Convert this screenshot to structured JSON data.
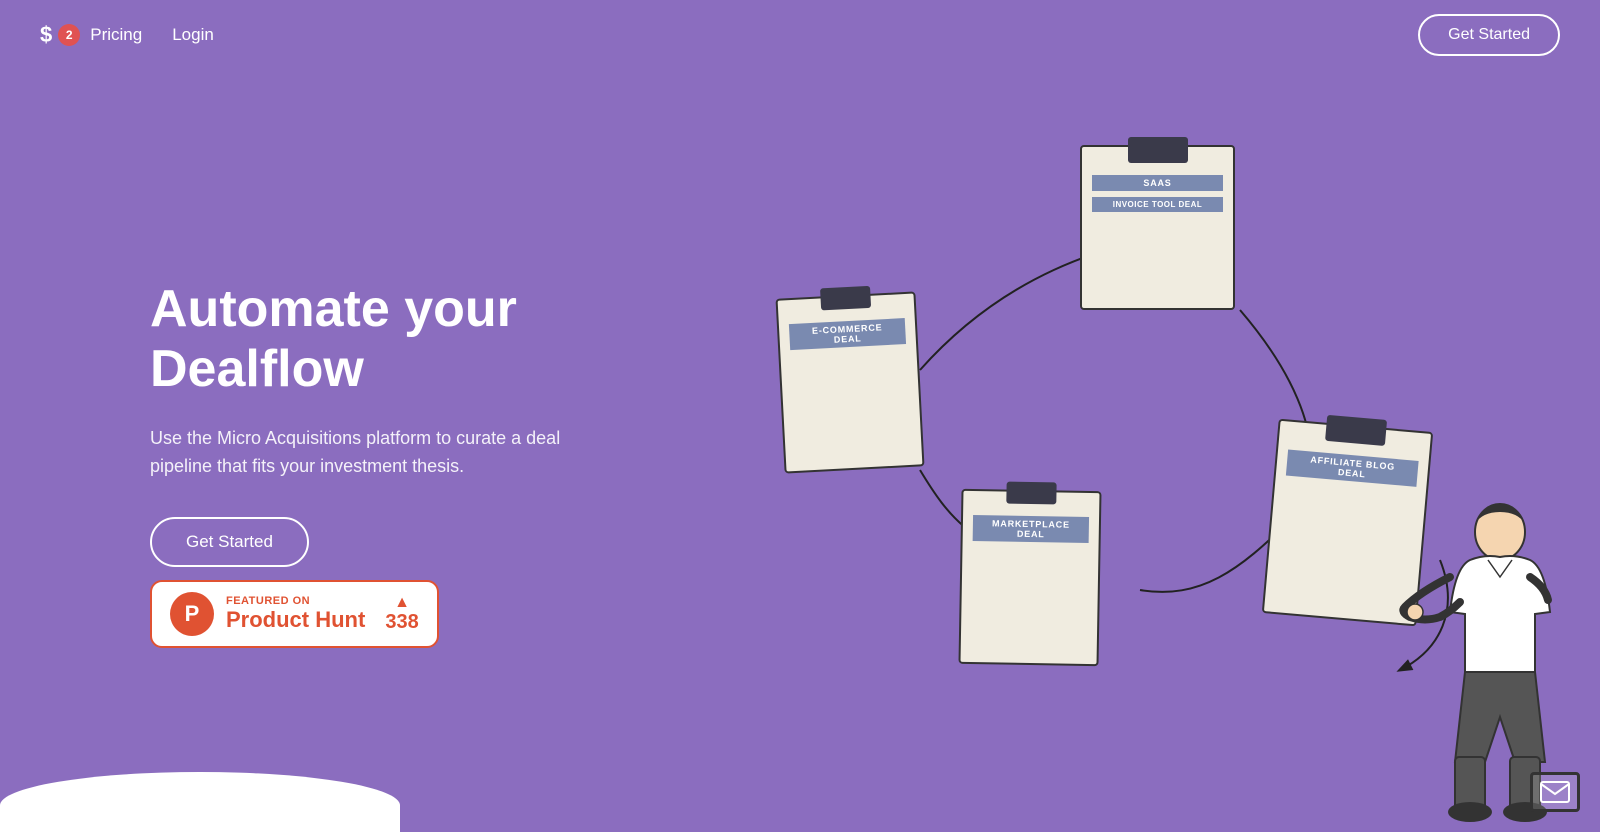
{
  "nav": {
    "logo_symbol": "$",
    "badge_count": "2",
    "links": [
      {
        "label": "Pricing",
        "href": "#"
      },
      {
        "label": "Login",
        "href": "#"
      }
    ],
    "cta_label": "Get Started"
  },
  "hero": {
    "title": "Automate your Dealflow",
    "subtitle": "Use the Micro Acquisitions platform to curate a deal pipeline that fits your investment thesis.",
    "cta_label": "Get Started"
  },
  "product_hunt": {
    "featured_text": "FEATURED ON",
    "name": "Product Hunt",
    "count": "338"
  },
  "deals": [
    {
      "id": "saas",
      "label": "SAAS",
      "label2": "INVOICE TOOL DEAL"
    },
    {
      "id": "ecommerce",
      "label": "E-COMMERCE DEAL",
      "label2": null
    },
    {
      "id": "marketplace",
      "label": "MARKETPLACE DEAL",
      "label2": null
    },
    {
      "id": "affiliate",
      "label": "AFFILIATE BLOG DEAL",
      "label2": null
    }
  ],
  "colors": {
    "background": "#8b6dbf",
    "card_bg": "#f0ece0",
    "label_bg": "#7a8ab0",
    "accent": "#e05232",
    "dark": "#333333"
  }
}
